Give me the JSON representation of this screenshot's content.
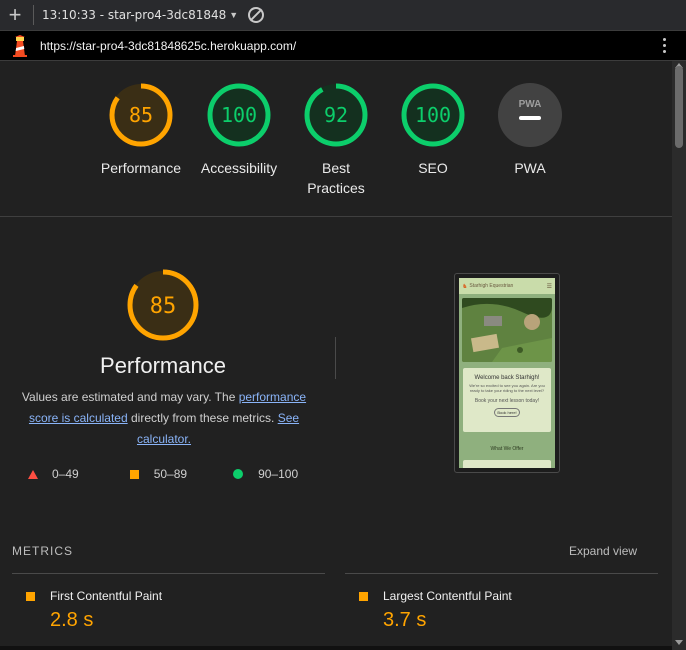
{
  "toolbar": {
    "plus_icon": "plus-icon",
    "title": "13:10:33 - star-pro4-3dc81848",
    "caret_icon": "caret-down-icon",
    "block_icon": "block-icon"
  },
  "urlbar": {
    "url": "https://star-pro4-3dc81848625c.herokuapp.com/",
    "logo_icon": "lighthouse-icon",
    "menu_icon": "kebab-menu-icon"
  },
  "colors": {
    "pass": "#0cce6b",
    "average": "#ffa400",
    "fail": "#ff4e42",
    "pwa": "#424242"
  },
  "gauges": [
    {
      "label_lines": [
        "Performance"
      ],
      "score": "85",
      "fraction": 0.85,
      "status": "average"
    },
    {
      "label_lines": [
        "Accessibility"
      ],
      "score": "100",
      "fraction": 1.0,
      "status": "pass"
    },
    {
      "label_lines": [
        "Best",
        "Practices"
      ],
      "score": "92",
      "fraction": 0.92,
      "status": "pass"
    },
    {
      "label_lines": [
        "SEO"
      ],
      "score": "100",
      "fraction": 1.0,
      "status": "pass"
    },
    {
      "label_lines": [
        "PWA"
      ],
      "score": "",
      "fraction": 0,
      "status": "pwa",
      "badge": "PWA"
    }
  ],
  "performance": {
    "score": "85",
    "fraction": 0.85,
    "title": "Performance",
    "desc_1": "Values are estimated and may vary. The ",
    "link_1": "performance score is calculated",
    "desc_2": " directly from these metrics. ",
    "link_2": "See calculator.",
    "legend": [
      {
        "icon": "triangle-icon",
        "range": "0–49"
      },
      {
        "icon": "square-icon",
        "range": "50–89"
      },
      {
        "icon": "circle-icon",
        "range": "90–100"
      }
    ]
  },
  "screenshot": {
    "site_name": "Starhigh Equestrian",
    "welcome": "Welcome back Starhigh!",
    "welcome_sub": "We're so excited to see you again. Are you ready to take your riding to the next level?",
    "book_line": "Book your next lesson today!",
    "book_button": "Book here!",
    "offer": "What We Offer"
  },
  "metrics": {
    "heading": "METRICS",
    "expand": "Expand view",
    "items": [
      {
        "name": "First Contentful Paint",
        "value": "2.8 s"
      },
      {
        "name": "Largest Contentful Paint",
        "value": "3.7 s"
      }
    ]
  }
}
